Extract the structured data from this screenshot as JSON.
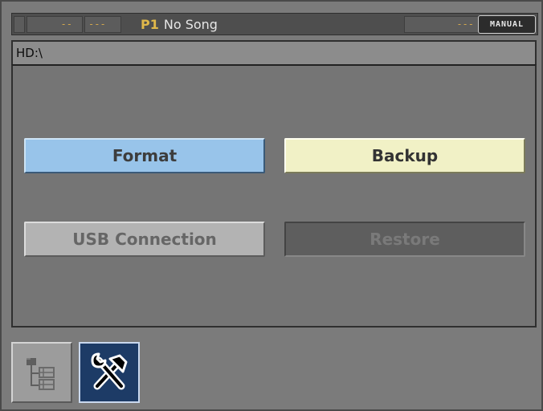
{
  "statusbar": {
    "seg1": "",
    "seg2": "--",
    "seg3": "---",
    "program": "P1",
    "song": "No Song",
    "seg4": "---",
    "mode": "MANUAL"
  },
  "path": "HD:\\",
  "buttons": {
    "format": "Format",
    "backup": "Backup",
    "usb": "USB Connection",
    "restore": "Restore"
  },
  "tabs": [
    {
      "icon": "file-browser-icon",
      "active": false
    },
    {
      "icon": "tools-icon",
      "active": true
    }
  ],
  "colors": {
    "format_btn": "#98c4ea",
    "backup_btn": "#f1f1c6",
    "usb_btn": "#b3b3b3",
    "restore_btn": "#5e5e5e",
    "active_tab": "#1d3b66"
  }
}
